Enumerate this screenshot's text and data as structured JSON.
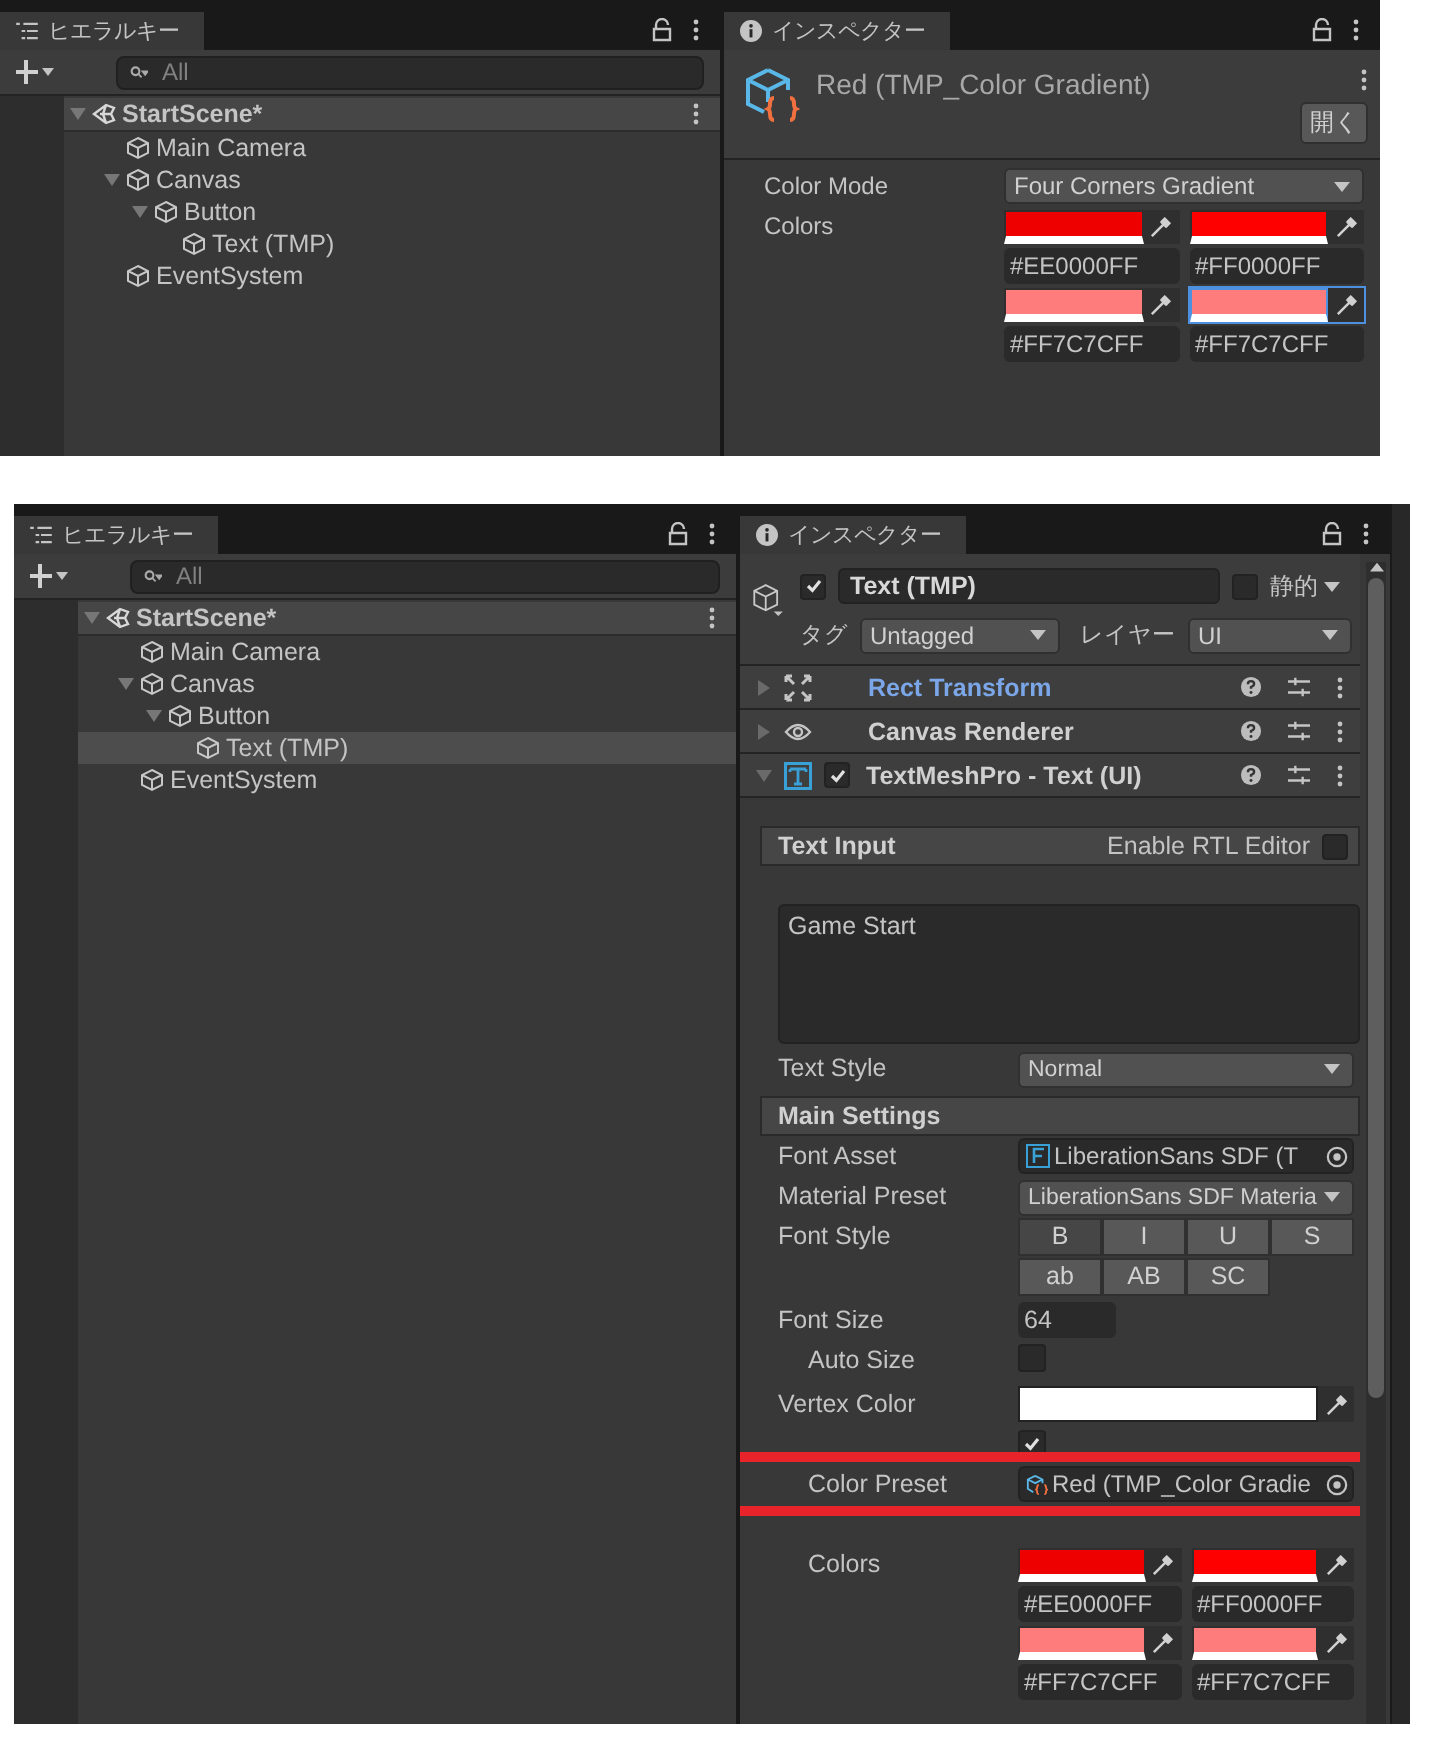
{
  "top": {
    "hierarchy": {
      "tab": "ヒエラルキー",
      "search": {
        "placeholder": "All"
      },
      "tree": [
        {
          "label": "StartScene*",
          "kind": "scene",
          "expanded": true,
          "selected": false,
          "children": [
            {
              "label": "Main Camera",
              "kind": "object",
              "selected": false
            },
            {
              "label": "Canvas",
              "kind": "object",
              "expanded": true,
              "selected": false,
              "children": [
                {
                  "label": "Button",
                  "kind": "object",
                  "expanded": true,
                  "selected": false,
                  "children": [
                    {
                      "label": "Text (TMP)",
                      "kind": "object",
                      "selected": false
                    }
                  ]
                }
              ]
            },
            {
              "label": "EventSystem",
              "kind": "object",
              "selected": false
            }
          ]
        }
      ]
    },
    "inspector": {
      "tab": "インスペクター",
      "title": "Red (TMP_Color Gradient)",
      "open_button": "開く",
      "rows": [
        {
          "kind": "dropdown",
          "label": "Color Mode",
          "value": "Four Corners Gradient"
        },
        {
          "kind": "colors",
          "label": "Colors",
          "swatches": [
            {
              "color": "#ee0000",
              "hex": "#EE0000FF",
              "selected": false
            },
            {
              "color": "#ff0000",
              "hex": "#FF0000FF",
              "selected": false
            },
            {
              "color": "#ff7c7c",
              "hex": "#FF7C7CFF",
              "selected": false
            },
            {
              "color": "#ff7c7c",
              "hex": "#FF7C7CFF",
              "selected": true
            }
          ]
        }
      ]
    }
  },
  "bottom": {
    "hierarchy": {
      "tab": "ヒエラルキー",
      "search": {
        "placeholder": "All"
      },
      "tree": [
        {
          "label": "StartScene*",
          "kind": "scene",
          "expanded": true,
          "selected": false,
          "children": [
            {
              "label": "Main Camera",
              "kind": "object",
              "selected": false
            },
            {
              "label": "Canvas",
              "kind": "object",
              "expanded": true,
              "selected": false,
              "children": [
                {
                  "label": "Button",
                  "kind": "object",
                  "expanded": true,
                  "selected": false,
                  "children": [
                    {
                      "label": "Text (TMP)",
                      "kind": "object",
                      "selected": true
                    }
                  ]
                }
              ]
            },
            {
              "label": "EventSystem",
              "kind": "object",
              "selected": false
            }
          ]
        }
      ]
    },
    "inspector": {
      "tab": "インスペクター",
      "active": true,
      "name": "Text (TMP)",
      "static": false,
      "static_label": "静的",
      "tag_label": "タグ",
      "tag": "Untagged",
      "layer_label": "レイヤー",
      "layer": "UI",
      "components": [
        {
          "kind": "rect-transform",
          "name": "Rect Transform",
          "expanded": false,
          "modified": true
        },
        {
          "kind": "canvas-renderer",
          "name": "Canvas Renderer",
          "expanded": false,
          "modified": false
        },
        {
          "kind": "text-mesh-pro",
          "name": "TextMeshPro - Text (UI)",
          "expanded": true,
          "modified": false,
          "enabled": true
        }
      ],
      "rows": [
        {
          "kind": "section",
          "label": "Text Input",
          "option": "Enable RTL Editor",
          "checked": false
        },
        {
          "kind": "textarea",
          "value": "Game Start"
        },
        {
          "kind": "dropdown",
          "label": "Text Style",
          "value": "Normal"
        },
        {
          "kind": "section",
          "label": "Main Settings"
        },
        {
          "kind": "font-object",
          "label": "Font Asset",
          "value": "LiberationSans SDF (T",
          "indent": false,
          "highlighted": false
        },
        {
          "kind": "dropdown",
          "label": "Material Preset",
          "value": "LiberationSans SDF Materia"
        },
        {
          "kind": "toggles",
          "label": "Font Style",
          "buttons": [
            {
              "label": "B",
              "selected": true
            },
            {
              "label": "I",
              "selected": false
            },
            {
              "label": "U",
              "selected": false
            },
            {
              "label": "S",
              "selected": false
            }
          ]
        },
        {
          "kind": "toggles",
          "buttons": [
            {
              "label": "ab",
              "selected": false
            },
            {
              "label": "AB",
              "selected": false
            },
            {
              "label": "SC",
              "selected": false
            }
          ]
        },
        {
          "kind": "number",
          "label": "Font Size",
          "value": "64"
        },
        {
          "kind": "checkbox",
          "label": "Auto Size",
          "indent": true,
          "checked": false
        },
        {
          "kind": "color",
          "label": "Vertex Color",
          "color": "#ffffff"
        },
        {
          "kind": "checkbox",
          "checked": true
        },
        {
          "kind": "preset-object",
          "label": "Color Preset",
          "value": "Red (TMP_Color Gradie",
          "indent": true,
          "highlighted": true
        },
        {
          "kind": "covered"
        },
        {
          "kind": "colors",
          "label": "Colors",
          "indent": true,
          "swatches": [
            {
              "color": "#ee0000",
              "hex": "#EE0000FF",
              "selected": false
            },
            {
              "color": "#ff0000",
              "hex": "#FF0000FF",
              "selected": false
            },
            {
              "color": "#ff7c7c",
              "hex": "#FF7C7CFF",
              "selected": false
            },
            {
              "color": "#ff7c7c",
              "hex": "#FF7C7CFF",
              "selected": false
            }
          ]
        }
      ]
    }
  }
}
